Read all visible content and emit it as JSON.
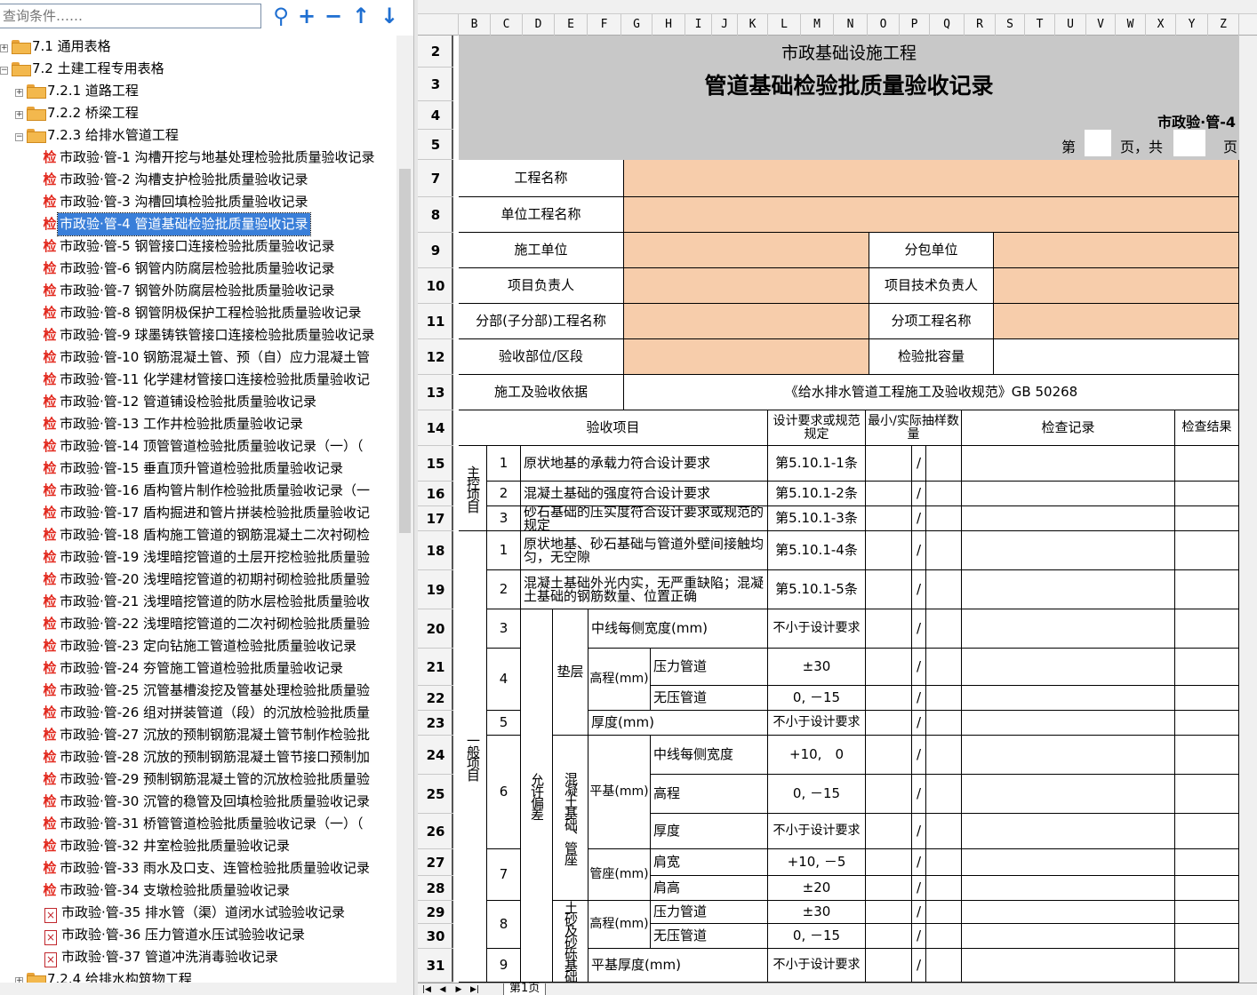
{
  "search": {
    "placeholder": "查询条件……"
  },
  "toolbar": {
    "search_icon": "search-icon",
    "add_icon": "plus-icon",
    "remove_icon": "minus-icon",
    "up_icon": "arrow-up-icon",
    "down_icon": "arrow-down-icon"
  },
  "tree": {
    "n71": "7.1 通用表格",
    "n72": "7.2 土建工程专用表格",
    "n721": "7.2.1 道路工程",
    "n722": "7.2.2 桥梁工程",
    "n723": "7.2.3 给排水管道工程",
    "n724": "7.2.4 给排水构筑物工程",
    "items": [
      "市政验·管-1 沟槽开挖与地基处理检验批质量验收记录",
      "市政验·管-2 沟槽支护检验批质量验收记录",
      "市政验·管-3 沟槽回填检验批质量验收记录",
      "市政验·管-4 管道基础检验批质量验收记录",
      "市政验·管-5 钢管接口连接检验批质量验收记录",
      "市政验·管-6 钢管内防腐层检验批质量验收记录",
      "市政验·管-7 钢管外防腐层检验批质量验收记录",
      "市政验·管-8 钢管阴极保护工程检验批质量验收记录",
      "市政验·管-9 球墨铸铁管接口连接检验批质量验收记录",
      "市政验·管-10 钢筋混凝土管、预（自）应力混凝土管",
      "市政验·管-11 化学建材管接口连接检验批质量验收记",
      "市政验·管-12 管道铺设检验批质量验收记录",
      "市政验·管-13 工作井检验批质量验收记录",
      "市政验·管-14 顶管管道检验批质量验收记录（一）（",
      "市政验·管-15 垂直顶升管道检验批质量验收记录",
      "市政验·管-16 盾构管片制作检验批质量验收记录（一",
      "市政验·管-17 盾构掘进和管片拼装检验批质量验收记",
      "市政验·管-18 盾构施工管道的钢筋混凝土二次衬砌检",
      "市政验·管-19 浅埋暗挖管道的土层开挖检验批质量验",
      "市政验·管-20 浅埋暗挖管道的初期衬砌检验批质量验",
      "市政验·管-21 浅埋暗挖管道的防水层检验批质量验收",
      "市政验·管-22 浅埋暗挖管道的二次衬砌检验批质量验",
      "市政验·管-23 定向钻施工管道检验批质量验收记录",
      "市政验·管-24 夯管施工管道检验批质量验收记录",
      "市政验·管-25 沉管基槽浚挖及管基处理检验批质量验",
      "市政验·管-26 组对拼装管道（段）的沉放检验批质量",
      "市政验·管-27 沉放的预制钢筋混凝土管节制作检验批",
      "市政验·管-28 沉放的预制钢筋混凝土管节接口预制加",
      "市政验·管-29 预制钢筋混凝土管的沉放检验批质量验",
      "市政验·管-30 沉管的稳管及回填检验批质量验收记录",
      "市政验·管-31 桥管管道检验批质量验收记录（一）（",
      "市政验·管-32 井室检验批质量验收记录",
      "市政验·管-33 雨水及口支、连管检验批质量验收记录",
      "市政验·管-34 支墩检验批质量验收记录",
      "市政验·管-35 排水管（渠）道闭水试验验收记录",
      "市政验·管-36 压力管道水压试验验收记录",
      "市政验·管-37 管道冲洗消毒验收记录"
    ],
    "check_glyph": "检",
    "pdf_glyph": "×"
  },
  "columns": [
    "B",
    "C",
    "D",
    "E",
    "F",
    "G",
    "H",
    "I",
    "J",
    "K",
    "L",
    "M",
    "N",
    "O",
    "P",
    "Q",
    "R",
    "S",
    "T",
    "U",
    "V",
    "W",
    "X",
    "Y",
    "Z"
  ],
  "rows": [
    "2",
    "3",
    "4",
    "5",
    "7",
    "8",
    "9",
    "10",
    "11",
    "12",
    "13",
    "14",
    "15",
    "16",
    "17",
    "18",
    "19",
    "20",
    "21",
    "22",
    "23",
    "24",
    "25",
    "26",
    "27",
    "28",
    "29",
    "30",
    "31"
  ],
  "form": {
    "subtitle": "市政基础设施工程",
    "title": "管道基础检验批质量验收记录",
    "code": "市政验·管-4",
    "page_prefix": "第",
    "page_mid": "页，共",
    "page_suffix": "页",
    "project_name": "工程名称",
    "unit_project": "单位工程名称",
    "contractor": "施工单位",
    "subcontractor": "分包单位",
    "pm": "项目负责人",
    "tech_lead": "项目技术负责人",
    "division": "分部(子分部)工程名称",
    "subitem": "分项工程名称",
    "location": "验收部位/区段",
    "capacity": "检验批容量",
    "basis_label": "施工及验收依据",
    "basis_value": "《给水排水管道工程施工及验收规范》GB 50268",
    "h_items": "验收项目",
    "h_design": "设计要求或规范规定",
    "h_sample": "最小/实际抽样数量",
    "h_record": "检查记录",
    "h_result": "检查结果",
    "main_ctrl": "主控项目",
    "general": "一般项目",
    "allow_dev": "允许偏差",
    "cushion": "垫层",
    "concrete_base": "混凝土基础、管座",
    "sand_base": "土砂及砂砾基础",
    "slash": "/",
    "m1": "原状地基的承载力符合设计要求",
    "m1v": "第5.10.1-1条",
    "m2": "混凝土基础的强度符合设计要求",
    "m2v": "第5.10.1-2条",
    "m3": "砂石基础的压实度符合设计要求或规范的规定",
    "m3v": "第5.10.1-3条",
    "g1": "原状地基、砂石基础与管道外壁间接触均匀，无空隙",
    "g1v": "第5.10.1-4条",
    "g2": "混凝土基础外光内实，无严重缺陷；混凝土基础的钢筋数量、位置正确",
    "g2v": "第5.10.1-5条",
    "center_width": "中线每侧宽度(mm)",
    "not_less": "不小于设计要求",
    "elev_mm": "高程(mm)",
    "pressure": "压力管道",
    "nonpressure": "无压管道",
    "pm30": "±30",
    "zero_m15": "0, －15",
    "thickness_mm": "厚度(mm)",
    "flat_mm": "平基(mm)",
    "center_width2": "中线每侧宽度",
    "p10_0": "+10,　0",
    "elev": "高程",
    "thick": "厚度",
    "seat_mm": "管座(mm)",
    "shoulder_w": "肩宽",
    "p10_m5": "+10, －5",
    "shoulder_h": "肩高",
    "pm20": "±20",
    "flat_thick": "平基厚度(mm)",
    "n1": "1",
    "n2": "2",
    "n3": "3",
    "n4": "4",
    "n5": "5",
    "n6": "6",
    "n7": "7",
    "n8": "8",
    "n9": "9"
  },
  "sheet_tab": "第1页",
  "colors": {
    "peach": "#f7cdab",
    "title_bg": "#c8c8c8",
    "accent": "#1f6fd1"
  }
}
